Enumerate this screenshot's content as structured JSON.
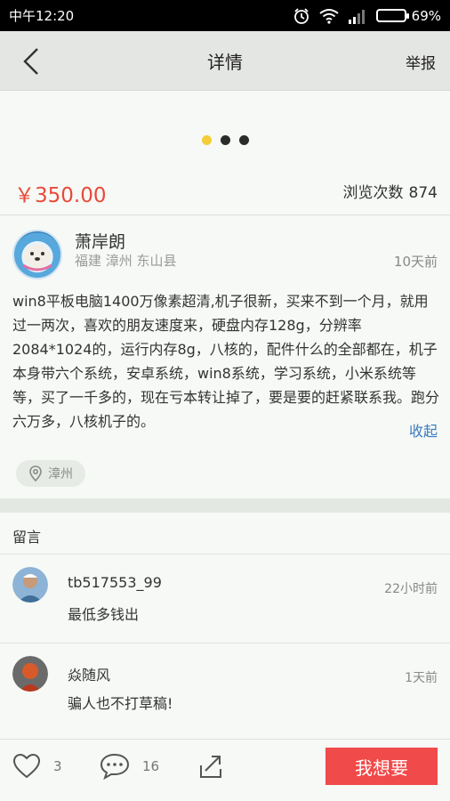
{
  "status_bar": {
    "time": "中午12:20",
    "battery_text": "69%",
    "battery_level": 0.69,
    "icons": [
      "alarm-icon",
      "wifi-icon",
      "signal-icon",
      "battery-icon"
    ]
  },
  "nav": {
    "title": "详情",
    "report_label": "举报"
  },
  "carousel": {
    "dot_count": 3,
    "active_index": 0,
    "active_color": "#f4cd38"
  },
  "listing": {
    "price": "￥350.00",
    "views_label": "浏览次数",
    "views_count": "874",
    "price_color": "#e84a3b"
  },
  "seller": {
    "name": "萧岸朗",
    "location": "福建 漳州 东山县",
    "posted_ago": "10天前",
    "description": "win8平板电脑1400万像素超清,机子很新，买来不到一个月，就用过一两次，喜欢的朋友速度来，硬盘内存128g，分辨率2084*1024的，运行内存8g，八核的，配件什么的全部都在，机子本身带六个系统，安卓系统，win8系统，学习系统，小米系统等等，买了一千多的，现在亏本转让掉了，要是要的赶紧联系我。跑分六万多，八核机子的。",
    "collapse_label": "收起",
    "location_tag": "漳州"
  },
  "comments": {
    "heading": "留言",
    "items": [
      {
        "user": "tb517553_99",
        "time": "22小时前",
        "text": "最低多钱出"
      },
      {
        "user": "焱随风",
        "time": "1天前",
        "text": "骗人也不打草稿!"
      }
    ]
  },
  "bottom_bar": {
    "like_count": "3",
    "comment_count": "16",
    "want_label": "我想要",
    "want_color": "#f04a4a"
  }
}
